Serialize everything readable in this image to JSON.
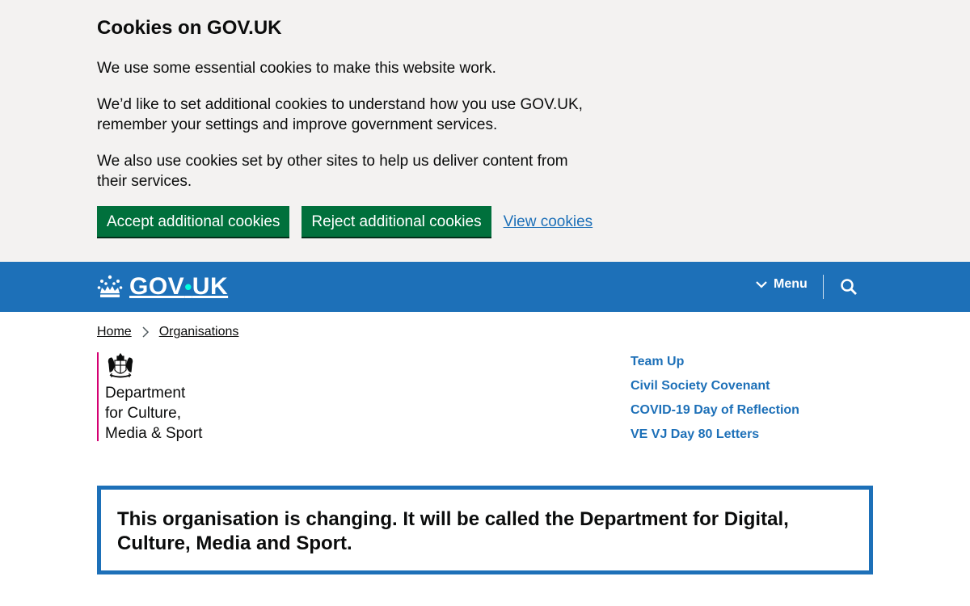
{
  "cookie_banner": {
    "title": "Cookies on GOV.UK",
    "paragraphs": [
      "We use some essential cookies to make this website work.",
      "We’d like to set additional cookies to understand how you use GOV.UK, remember your settings and improve government services.",
      "We also use cookies set by other sites to help us deliver content from their services."
    ],
    "accept_label": "Accept additional cookies",
    "reject_label": "Reject additional cookies",
    "view_label": "View cookies"
  },
  "header": {
    "logo_part1": "GOV",
    "logo_dot": "•",
    "logo_part2": "UK",
    "menu_label": "Menu",
    "search_icon": "search-icon",
    "crown_icon": "crown-icon",
    "background": "#1d70b8"
  },
  "breadcrumb": {
    "items": [
      "Home",
      "Organisations"
    ]
  },
  "organisation": {
    "name": "Department\nfor Culture,\nMedia & Sport",
    "crest_icon": "royal-crest-icon",
    "brand_colour": "#d40072"
  },
  "featured_links": [
    "Team Up",
    "Civil Society Covenant",
    "COVID-19 Day of Reflection",
    "VE VJ Day 80 Letters"
  ],
  "notice": {
    "text": "This organisation is changing. It will be called the Department for Digital, Culture, Media and Sport."
  },
  "colors": {
    "button_green": "#00703c",
    "link_blue": "#1d70b8",
    "banner_grey": "#f3f2f1"
  }
}
